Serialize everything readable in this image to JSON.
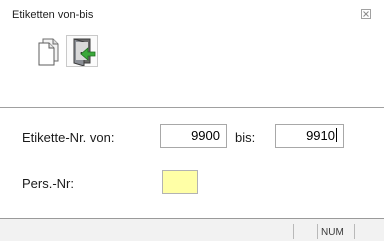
{
  "window": {
    "title": "Etiketten von-bis"
  },
  "toolbar": {
    "buttons": [
      {
        "icon": "new-document-icon"
      },
      {
        "icon": "exit-door-icon"
      }
    ]
  },
  "form": {
    "von_label": "Etikette-Nr. von:",
    "von_value": "9900",
    "bis_label": "bis:",
    "bis_value": "9910",
    "pers_label": "Pers.-Nr:",
    "pers_value": ""
  },
  "statusbar": {
    "num_indicator": "NUM"
  },
  "colors": {
    "highlight_field": "#ffffa6",
    "separator": "#a0a0a0",
    "exit_arrow": "#3aa83a"
  }
}
